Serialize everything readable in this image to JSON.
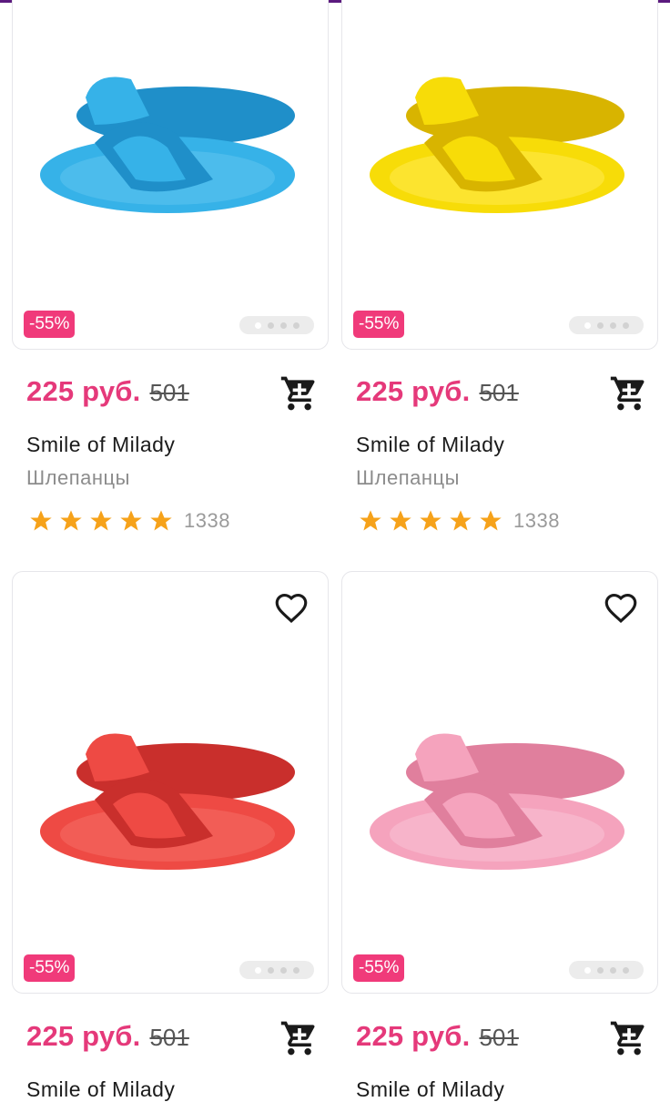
{
  "products": [
    {
      "discount": "-55%",
      "price": "225 руб.",
      "old_price": "501",
      "brand": "Smile of Milady",
      "category": "Шлепанцы",
      "reviews": "1338",
      "color": "#36b2e8",
      "shade": "#1f8fc9"
    },
    {
      "discount": "-55%",
      "price": "225 руб.",
      "old_price": "501",
      "brand": "Smile of Milady",
      "category": "Шлепанцы",
      "reviews": "1338",
      "color": "#f7dc08",
      "shade": "#d8b400"
    },
    {
      "discount": "-55%",
      "price": "225 руб.",
      "old_price": "501",
      "brand": "Smile of Milady",
      "category": "",
      "reviews": "",
      "color": "#ee4a44",
      "shade": "#c92f2c"
    },
    {
      "discount": "-55%",
      "price": "225 руб.",
      "old_price": "501",
      "brand": "Smile of Milady",
      "category": "",
      "reviews": "",
      "color": "#f5a3bd",
      "shade": "#e07f9d"
    }
  ],
  "icons": {
    "cart": "shopping-cart-icon",
    "favorite": "heart-outline-icon",
    "star": "star-icon"
  },
  "colors": {
    "accent": "#e5397a",
    "badge": "#f03a7a",
    "star": "#f6a21a"
  }
}
